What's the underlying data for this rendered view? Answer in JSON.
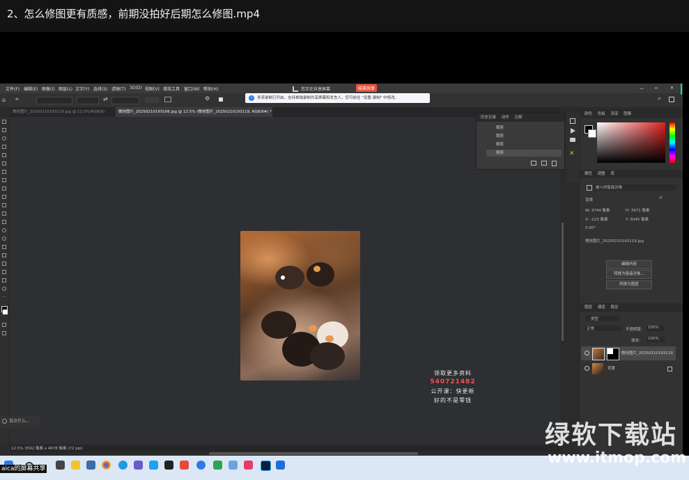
{
  "video_title": "2、怎么修图更有质感，前期没拍好后期怎么修图.mp4",
  "ps": {
    "menu": [
      "文件(F)",
      "编辑(E)",
      "图像(I)",
      "图层(L)",
      "文字(Y)",
      "选择(S)",
      "滤镜(T)",
      "3D(D)",
      "视图(V)",
      "增效工具",
      "窗口(W)",
      "帮助(H)"
    ],
    "share_status": "您正在共享屏幕",
    "end_share_label": "结束共享",
    "notice": "多流录制已开启。支持单独录制共享屏幕和发言人，您可前往 \"设置-录制\" 中修改。",
    "tabs": [
      "微信图片_20250210193119.jpg @ 12.5%(RGB/8)",
      "微信图片_20250210193106.jpg @ 12.5% (微信图片_20250210193119, RGB/8#) *"
    ],
    "history_panel": {
      "tabs": [
        "历史记录",
        "动作",
        "注释"
      ],
      "items": [
        "裁剪",
        "裁剪",
        "裁剪",
        "裁剪"
      ]
    },
    "color_panel_tabs": [
      "颜色",
      "色板",
      "渐变",
      "图案"
    ],
    "properties": {
      "tabs": [
        "属性",
        "调整",
        "库"
      ],
      "kind": "嵌入的智能对象",
      "transform_label": "变换",
      "w": "W: 3744 像素",
      "h": "H: 3971 像素",
      "x": "X: -223 像素",
      "y": "Y: 3045 像素",
      "angle": "0.00°",
      "filename": "微信图片_20250210193119.jpg",
      "buttons": [
        "编辑内容",
        "转换为链接对象...",
        "转换为图层"
      ]
    },
    "layers": {
      "tabs": [
        "图层",
        "通道",
        "路径"
      ],
      "kind_filter": "类型",
      "blend_mode": "正常",
      "opacity_label": "不透明度:",
      "opacity": "100%",
      "fill_label": "填充:",
      "fill": "100%",
      "rows": [
        "微信图片_20250210193119",
        "背景"
      ]
    },
    "status": "12.5%   3592 像素 x 4678 像素 (72 ppi)",
    "canvas_text": [
      "领取更多资料",
      "540721482",
      "公开课：快更新",
      "好的不是零钱"
    ]
  },
  "chat_prompt": "说点什么...",
  "taskbar": {
    "share_label": "aica的屏幕共享"
  },
  "site_watermark": {
    "name": "绿软下载站",
    "url": "www.itmop.com"
  },
  "colors": {
    "accent_green": "#22d3a6",
    "end_share_red": "#e8543e",
    "link_blue": "#2f7de1"
  }
}
